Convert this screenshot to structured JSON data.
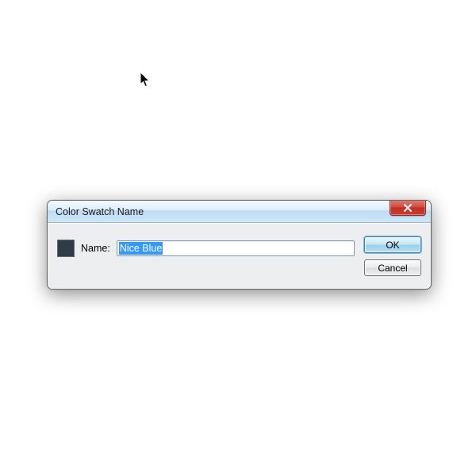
{
  "dialog": {
    "title": "Color Swatch Name",
    "swatch_color": "#2f3b48",
    "name_label": "Name:",
    "name_value": "Nice Blue",
    "ok_label": "OK",
    "cancel_label": "Cancel"
  }
}
